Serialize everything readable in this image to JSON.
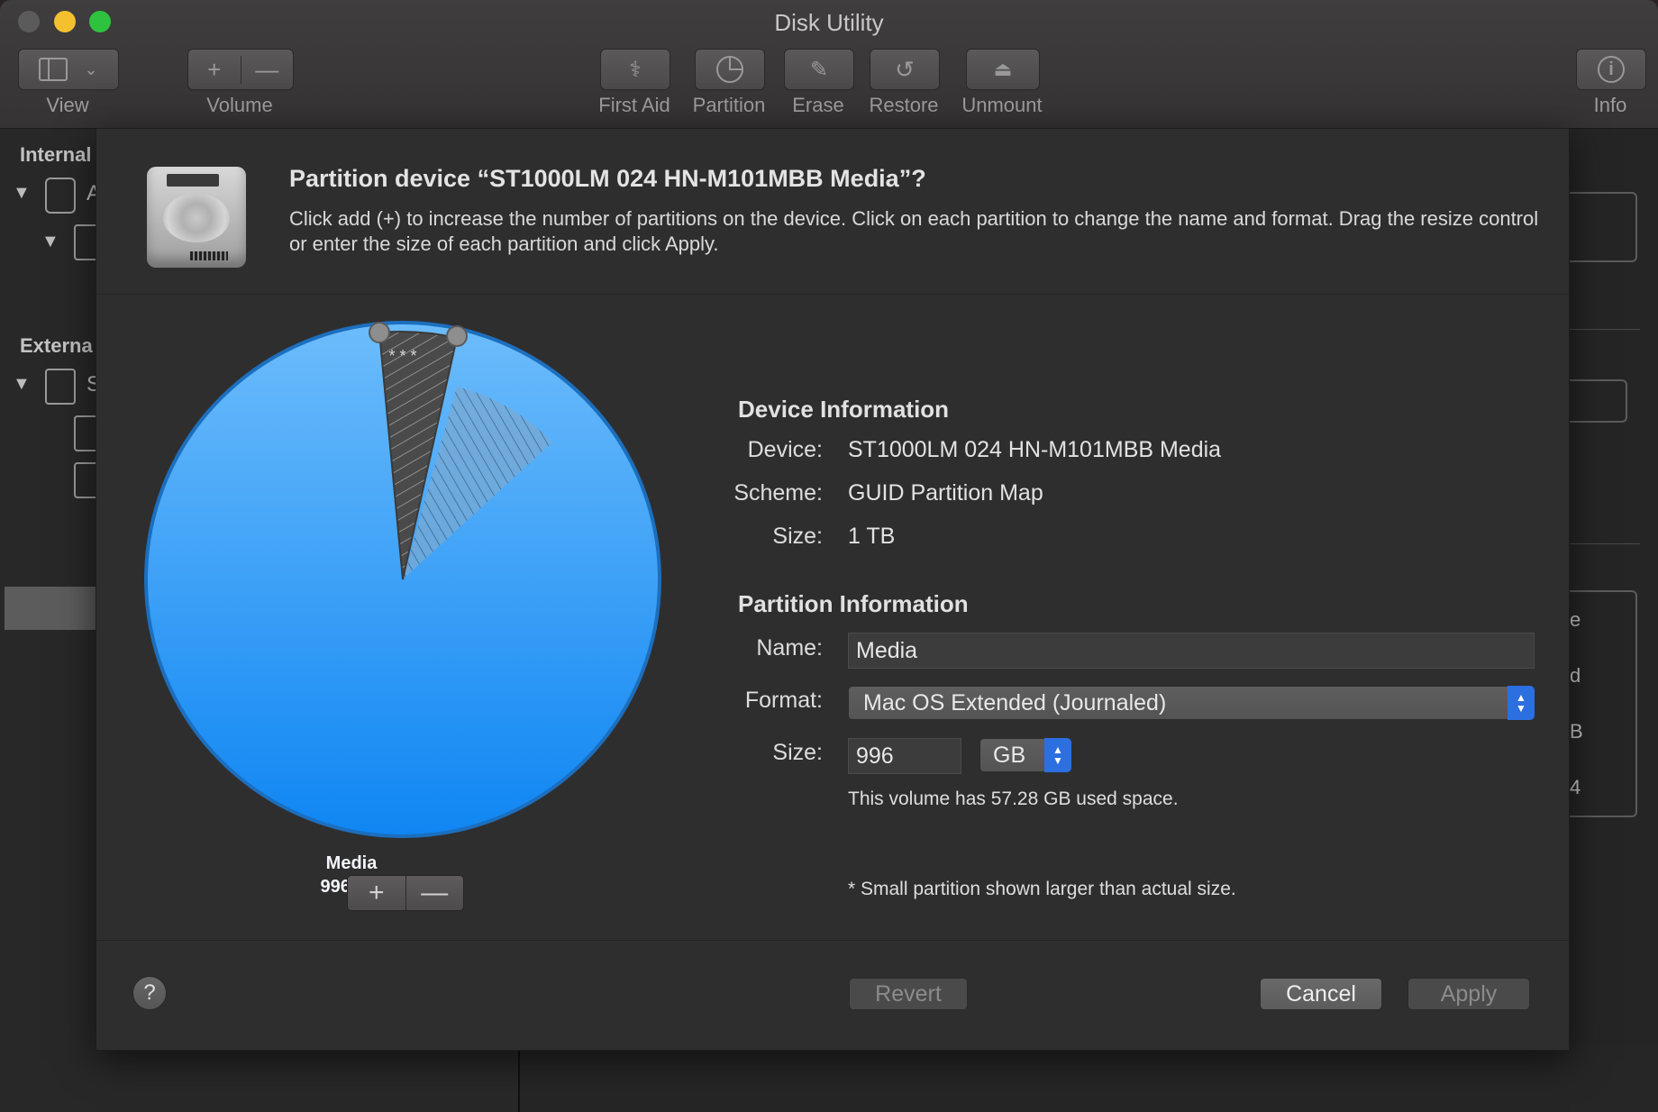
{
  "window": {
    "title": "Disk Utility"
  },
  "toolbar": {
    "view_label": "View",
    "volume_label": "Volume",
    "first_aid_label": "First Aid",
    "partition_label": "Partition",
    "erase_label": "Erase",
    "restore_label": "Restore",
    "unmount_label": "Unmount",
    "info_label": "Info",
    "add_glyph": "+",
    "remove_glyph": "—"
  },
  "sidebar": {
    "internal_heading": "Internal",
    "external_heading": "Externa",
    "internal_disk_partial": "A",
    "external_disk_partial": "S"
  },
  "right_panel": {
    "partial_chars": [
      "e",
      "d",
      "B",
      "4"
    ]
  },
  "dialog": {
    "title": "Partition device “ST1000LM 024 HN-M101MBB Media”?",
    "description": "Click add (+) to increase the number of partitions on the device. Click on each partition to change the name and format. Drag the resize control or enter the size of each partition and click Apply.",
    "pie": {
      "partition_name": "Media",
      "partition_size": "996 GB",
      "small_marker": "* * *",
      "add_glyph": "+",
      "remove_glyph": "—",
      "colors": {
        "partition": "#2f9bf8",
        "handle": "#8e8e8e"
      }
    },
    "device_info": {
      "heading": "Device Information",
      "device_label": "Device:",
      "device_value": "ST1000LM 024 HN-M101MBB Media",
      "scheme_label": "Scheme:",
      "scheme_value": "GUID Partition Map",
      "size_label": "Size:",
      "size_value": "1 TB"
    },
    "partition_info": {
      "heading": "Partition Information",
      "name_label": "Name:",
      "name_value": "Media",
      "format_label": "Format:",
      "format_value": "Mac OS Extended (Journaled)",
      "size_label": "Size:",
      "size_value": "996",
      "size_unit": "GB",
      "used_note": "This volume has 57.28 GB used space.",
      "small_note": "* Small partition shown larger than actual size."
    },
    "buttons": {
      "help": "?",
      "revert": "Revert",
      "cancel": "Cancel",
      "apply": "Apply"
    }
  }
}
